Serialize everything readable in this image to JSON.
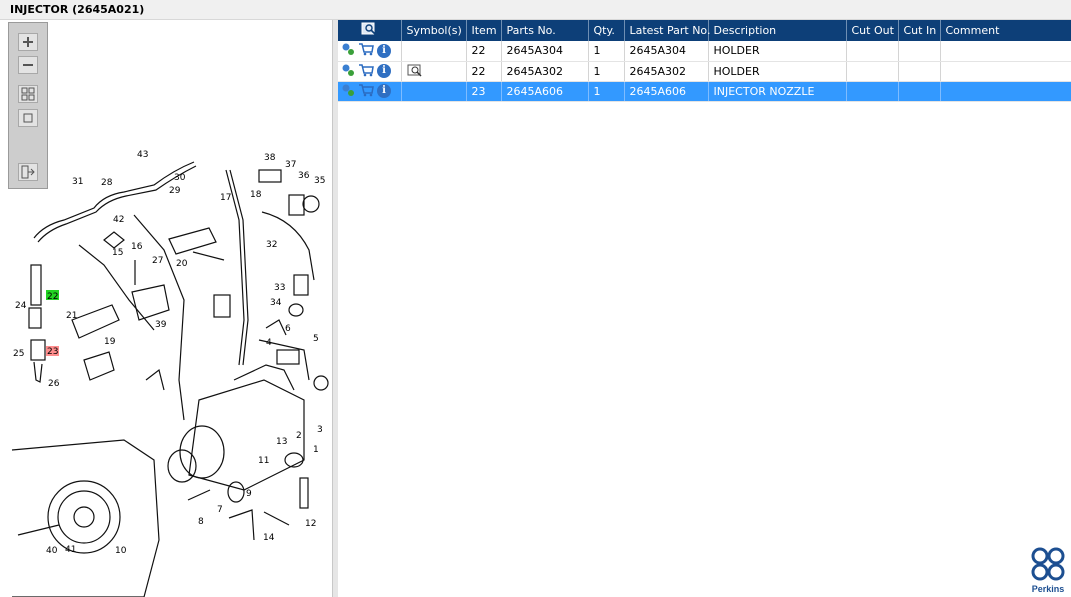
{
  "window": {
    "title": "INJECTOR (2645A021)"
  },
  "toolbar": {
    "tools": [
      {
        "name": "zoom-in-icon"
      },
      {
        "name": "zoom-out-icon"
      },
      {
        "name": "fit-all-icon"
      },
      {
        "name": "actual-size-icon"
      },
      {
        "name": "export-icon"
      }
    ]
  },
  "table": {
    "columns": [
      "",
      "Symbol(s)",
      "Item",
      "Parts No.",
      "Qty.",
      "Latest Part No.",
      "Description",
      "Cut Out",
      "Cut In",
      "Comment"
    ],
    "rows": [
      {
        "icons": [
          "gears-icon",
          "cart-icon",
          "info-icon"
        ],
        "symbol": "",
        "item": "22",
        "parts_no": "2645A304",
        "qty": "1",
        "latest": "2645A304",
        "description": "HOLDER",
        "cut_out": "",
        "cut_in": "",
        "comment": "",
        "selected": false
      },
      {
        "icons": [
          "gears-icon",
          "cart-icon",
          "info-icon"
        ],
        "symbol": "book-icon",
        "item": "22",
        "parts_no": "2645A302",
        "qty": "1",
        "latest": "2645A302",
        "description": "HOLDER",
        "cut_out": "",
        "cut_in": "",
        "comment": "",
        "selected": false
      },
      {
        "icons": [
          "gears-icon",
          "cart-icon",
          "info-icon"
        ],
        "symbol": "",
        "item": "23",
        "parts_no": "2645A606",
        "qty": "1",
        "latest": "2645A606",
        "description": "INJECTOR NOZZLE",
        "cut_out": "",
        "cut_in": "",
        "comment": "",
        "selected": true
      }
    ]
  },
  "diagram": {
    "callouts": [
      "43",
      "38",
      "37",
      "36",
      "35",
      "31",
      "28",
      "30",
      "29",
      "17",
      "18",
      "42",
      "32",
      "16",
      "15",
      "27",
      "20",
      "22",
      "24",
      "21",
      "33",
      "34",
      "39",
      "25",
      "23",
      "19",
      "6",
      "5",
      "4",
      "26",
      "3",
      "2",
      "13",
      "1",
      "9",
      "11",
      "8",
      "7",
      "12",
      "14",
      "10",
      "40",
      "41"
    ],
    "highlight": {
      "green": "22",
      "red": "23"
    },
    "colors": {
      "highlight_green": "#22d322",
      "highlight_red": "#ff8d8d"
    }
  },
  "brand": {
    "logo_text": "Perkins",
    "accent": "#1d4f91",
    "header_bg": "#0d3f78",
    "selection": "#3399ff"
  }
}
